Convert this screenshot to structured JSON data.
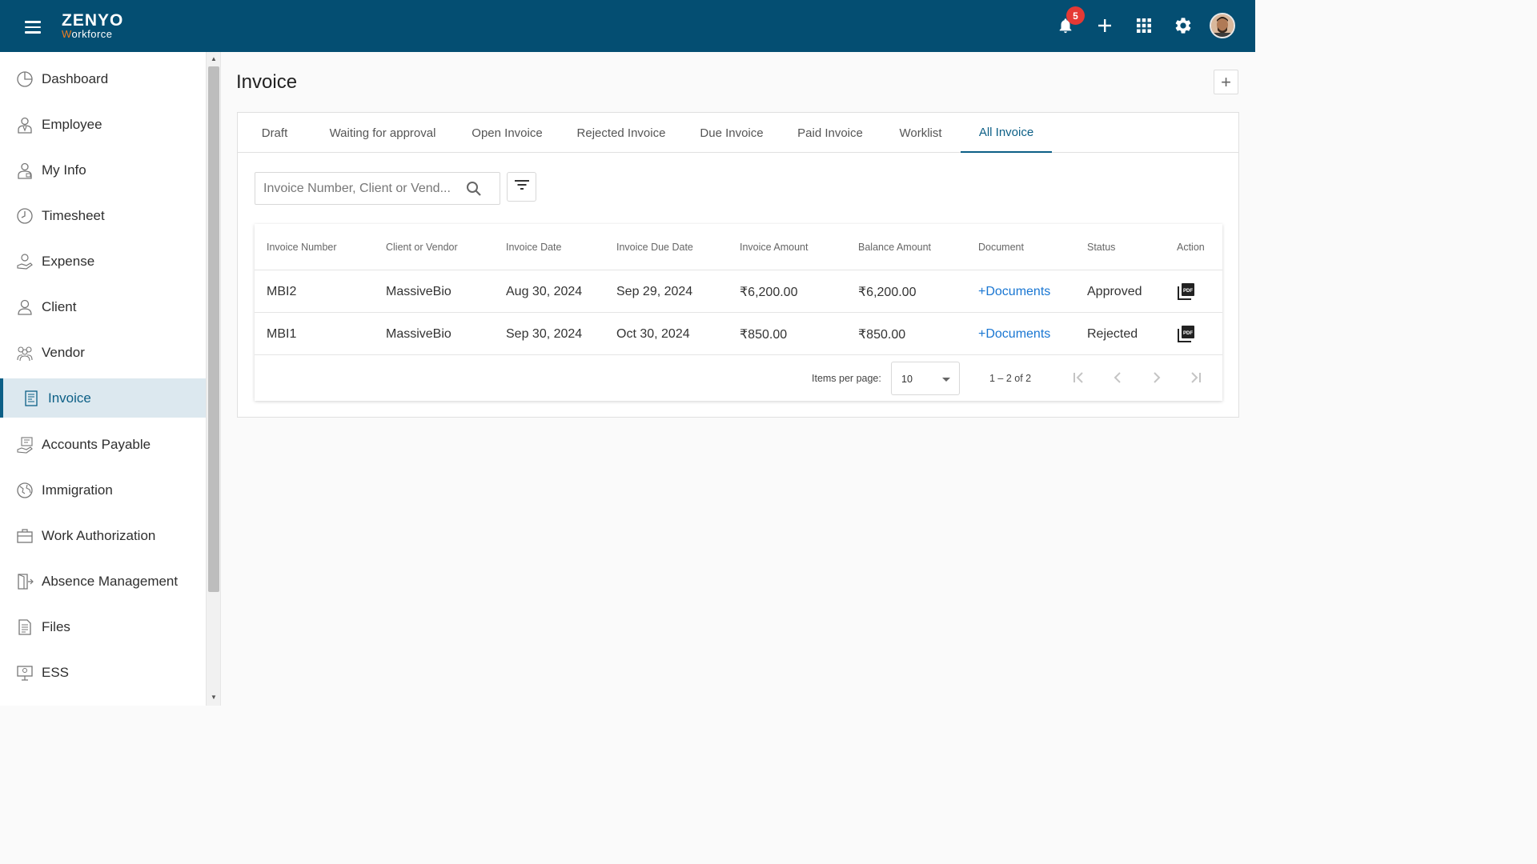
{
  "app": {
    "brand": "ZENYO",
    "brand_sub": "Workforce",
    "notification_count": "5"
  },
  "sidebar": {
    "items": [
      {
        "label": "Dashboard",
        "icon": "dashboard-icon"
      },
      {
        "label": "Employee",
        "icon": "employee-icon"
      },
      {
        "label": "My Info",
        "icon": "my-info-icon"
      },
      {
        "label": "Timesheet",
        "icon": "clock-icon"
      },
      {
        "label": "Expense",
        "icon": "expense-icon"
      },
      {
        "label": "Client",
        "icon": "client-icon"
      },
      {
        "label": "Vendor",
        "icon": "vendor-icon"
      },
      {
        "label": "Invoice",
        "icon": "invoice-icon",
        "active": true
      },
      {
        "label": "Accounts Payable",
        "icon": "accounts-payable-icon"
      },
      {
        "label": "Immigration",
        "icon": "globe-icon"
      },
      {
        "label": "Work Authorization",
        "icon": "briefcase-icon"
      },
      {
        "label": "Absence Management",
        "icon": "exit-door-icon"
      },
      {
        "label": "Files",
        "icon": "file-icon"
      },
      {
        "label": "ESS",
        "icon": "ess-icon"
      }
    ]
  },
  "page": {
    "title": "Invoice",
    "add_label": "+"
  },
  "tabs": [
    {
      "label": "Draft"
    },
    {
      "label": "Waiting for approval"
    },
    {
      "label": "Open Invoice"
    },
    {
      "label": "Rejected Invoice"
    },
    {
      "label": "Due Invoice"
    },
    {
      "label": "Paid Invoice"
    },
    {
      "label": "Worklist"
    },
    {
      "label": "All Invoice",
      "active": true
    }
  ],
  "search": {
    "placeholder": "Invoice Number, Client or Vend...",
    "value": ""
  },
  "table": {
    "columns": [
      "Invoice Number",
      "Client or Vendor",
      "Invoice Date",
      "Invoice Due Date",
      "Invoice Amount",
      "Balance Amount",
      "Document",
      "Status",
      "Action"
    ],
    "rows": [
      {
        "invoice_number": "MBI2",
        "client": "MassiveBio",
        "invoice_date": "Aug 30, 2024",
        "due_date": "Sep 29, 2024",
        "amount": "₹6,200.00",
        "balance": "₹6,200.00",
        "document": "+Documents",
        "status": "Approved"
      },
      {
        "invoice_number": "MBI1",
        "client": "MassiveBio",
        "invoice_date": "Sep 30, 2024",
        "due_date": "Oct 30, 2024",
        "amount": "₹850.00",
        "balance": "₹850.00",
        "document": "+Documents",
        "status": "Rejected"
      }
    ]
  },
  "pagination": {
    "items_per_page_label": "Items per page:",
    "items_per_page": "10",
    "range": "1 – 2 of 2"
  },
  "colors": {
    "topbar": "#044e72",
    "accent": "#0c5f86",
    "link": "#1976d2",
    "logo_accent": "#f07d21"
  }
}
